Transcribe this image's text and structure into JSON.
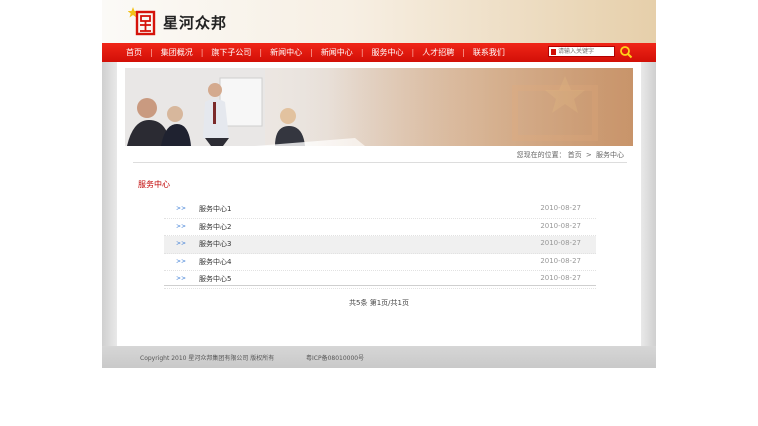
{
  "header": {
    "logo_text": "星河众邦"
  },
  "nav": {
    "items": [
      "首页",
      "集团概况",
      "旗下子公司",
      "新闻中心",
      "新闻中心",
      "服务中心",
      "人才招聘",
      "联系我们"
    ],
    "search_placeholder": "请输入关键字"
  },
  "breadcrumb": {
    "prefix": "您现在的位置：",
    "home": "首页",
    "separator": ">",
    "current": "服务中心"
  },
  "main": {
    "section_title": "服务中心",
    "list": [
      {
        "arrow": ">>",
        "title": "服务中心1",
        "date": "2010-08-27"
      },
      {
        "arrow": ">>",
        "title": "服务中心2",
        "date": "2010-08-27"
      },
      {
        "arrow": ">>",
        "title": "服务中心3",
        "date": "2010-08-27"
      },
      {
        "arrow": ">>",
        "title": "服务中心4",
        "date": "2010-08-27"
      },
      {
        "arrow": ">>",
        "title": "服务中心5",
        "date": "2010-08-27"
      }
    ],
    "pager": "共5条 第1页/共1页"
  },
  "footer": {
    "copyright": "Copyright 2010 星河众邦集团有限公司 版权所有",
    "icp": "粤ICP备08010000号"
  },
  "colors": {
    "nav_red": "#d20f07",
    "title_red": "#c00000",
    "arrow_blue": "#3a7bd5"
  }
}
